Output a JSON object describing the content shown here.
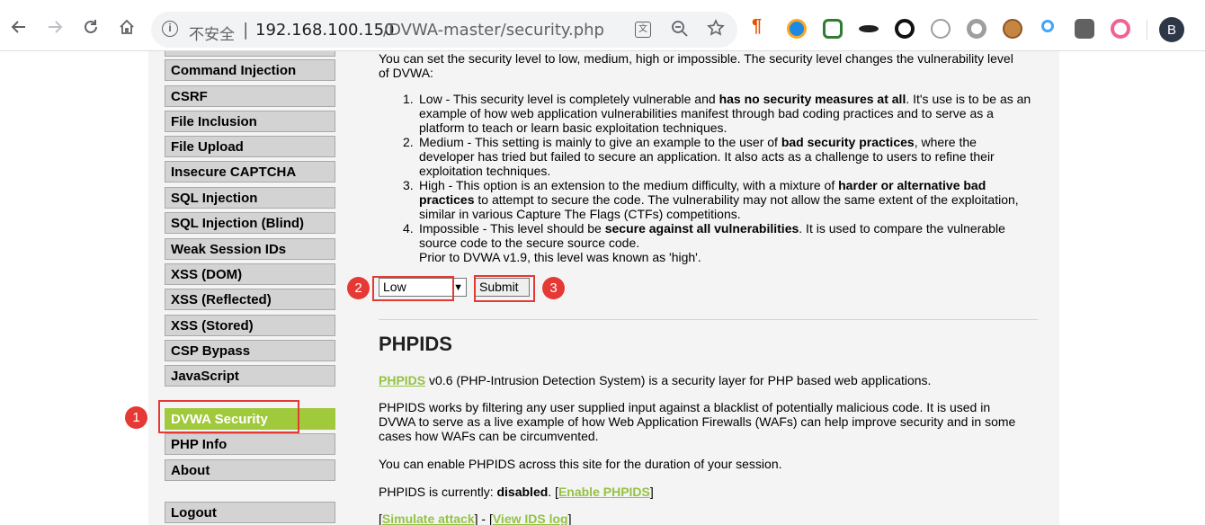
{
  "browser": {
    "security_label": "不安全",
    "url_host": "192.168.100.150",
    "url_path": "/DVWA-master/security.php",
    "profile_initial": "B"
  },
  "sidebar": {
    "items": [
      {
        "label": "Command Injection"
      },
      {
        "label": "CSRF"
      },
      {
        "label": "File Inclusion"
      },
      {
        "label": "File Upload"
      },
      {
        "label": "Insecure CAPTCHA"
      },
      {
        "label": "SQL Injection"
      },
      {
        "label": "SQL Injection (Blind)"
      },
      {
        "label": "Weak Session IDs"
      },
      {
        "label": "XSS (DOM)"
      },
      {
        "label": "XSS (Reflected)"
      },
      {
        "label": "XSS (Stored)"
      },
      {
        "label": "CSP Bypass"
      },
      {
        "label": "JavaScript"
      },
      {
        "label": "DVWA Security",
        "active": true
      },
      {
        "label": "PHP Info"
      },
      {
        "label": "About"
      },
      {
        "label": "Logout"
      }
    ]
  },
  "security": {
    "intro": "You can set the security level to low, medium, high or impossible. The security level changes the vulnerability level of DVWA:",
    "levels": [
      {
        "num": "1.",
        "pre": "Low - This security level is completely vulnerable and ",
        "bold": "has no security measures at all",
        "post": ". It's use is to be as an example of how web application vulnerabilities manifest through bad coding practices and to serve as a platform to teach or learn basic exploitation techniques."
      },
      {
        "num": "2.",
        "pre": "Medium - This setting is mainly to give an example to the user of ",
        "bold": "bad security practices",
        "post": ", where the developer has tried but failed to secure an application. It also acts as a challenge to users to refine their exploitation techniques."
      },
      {
        "num": "3.",
        "pre": "High - This option is an extension to the medium difficulty, with a mixture of ",
        "bold": "harder or alternative bad practices",
        "post": " to attempt to secure the code. The vulnerability may not allow the same extent of the exploitation, similar in various Capture The Flags (CTFs) competitions."
      },
      {
        "num": "4.",
        "pre": "Impossible - This level should be ",
        "bold": "secure against all vulnerabilities",
        "post": ". It is used to compare the vulnerable source code to the secure source code."
      }
    ],
    "prior_note": "Prior to DVWA v1.9, this level was known as 'high'.",
    "select_value": "Low",
    "submit_label": "Submit"
  },
  "phpids": {
    "heading": "PHPIDS",
    "link_label": "PHPIDS",
    "desc_rest": " v0.6 (PHP-Intrusion Detection System) is a security layer for PHP based web applications.",
    "works": "PHPIDS works by filtering any user supplied input against a blacklist of potentially malicious code. It is used in DVWA to serve as a live example of how Web Application Firewalls (WAFs) can help improve security and in some cases how WAFs can be circumvented.",
    "enable_note": "You can enable PHPIDS across this site for the duration of your session.",
    "status_prefix": "PHPIDS is currently: ",
    "status_value": "disabled",
    "status_mid": ". [",
    "enable_link": "Enable PHPIDS",
    "status_suffix": "]",
    "bracket_open": "[",
    "simulate_link": "Simulate attack",
    "sep": "] - [",
    "view_log_link": "View IDS log",
    "bracket_close": "]"
  },
  "annotations": [
    "1",
    "2",
    "3"
  ],
  "colors": {
    "accent_green": "#94c244",
    "active_menu": "#a0c93c",
    "annotation_red": "#e53935"
  }
}
